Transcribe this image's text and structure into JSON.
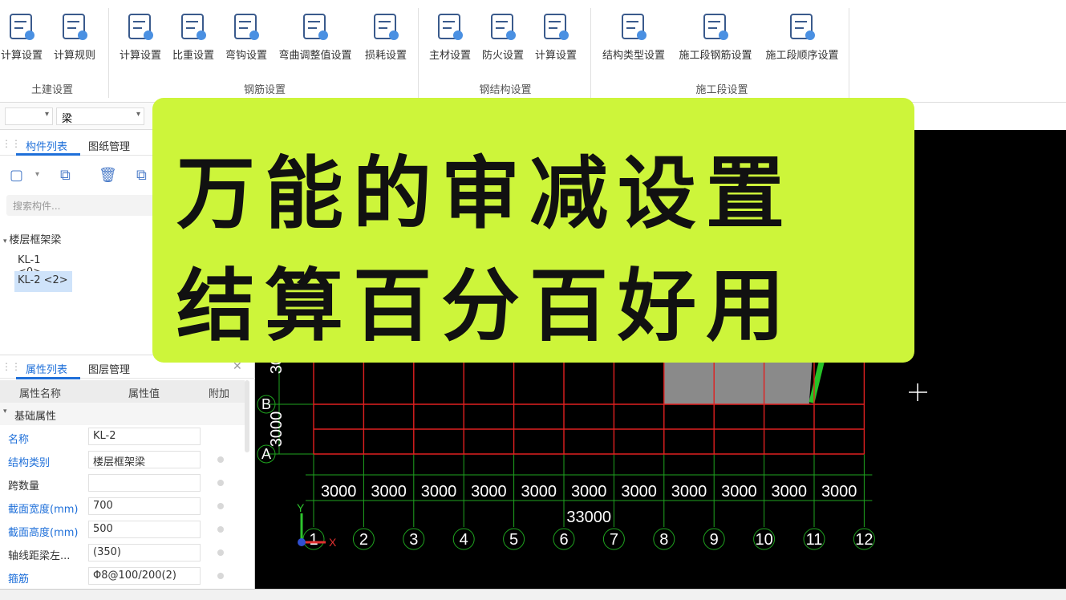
{
  "ribbon": {
    "tools": [
      {
        "label": "计算设置",
        "icon": "calc-settings-icon"
      },
      {
        "label": "计算规则",
        "icon": "calc-rules-icon"
      },
      {
        "label": "计算设置",
        "icon": "calc-settings-icon"
      },
      {
        "label": "比重设置",
        "icon": "density-settings-icon"
      },
      {
        "label": "弯钩设置",
        "icon": "hook-settings-icon"
      },
      {
        "label": "弯曲调整值设置",
        "icon": "bend-adjust-icon"
      },
      {
        "label": "损耗设置",
        "icon": "loss-settings-icon"
      },
      {
        "label": "主材设置",
        "icon": "main-material-icon"
      },
      {
        "label": "防火设置",
        "icon": "fireproof-icon"
      },
      {
        "label": "计算设置",
        "icon": "calc-settings-icon"
      },
      {
        "label": "结构类型设置",
        "icon": "structure-type-icon"
      },
      {
        "label": "施工段钢筋设置",
        "icon": "segment-rebar-icon"
      },
      {
        "label": "施工段顺序设置",
        "icon": "segment-order-icon"
      }
    ],
    "groups": [
      "土建设置",
      "钢筋设置",
      "钢结构设置",
      "施工段设置"
    ]
  },
  "left": {
    "filter_value": "梁",
    "tabs_top": [
      "构件列表",
      "图纸管理"
    ],
    "search_placeholder": "搜索构件...",
    "tree_root": "楼层框架梁",
    "tree_items": [
      "KL-1 <0>",
      "KL-2 <2>"
    ],
    "tabs_bottom": [
      "属性列表",
      "图层管理"
    ],
    "prop_headers": [
      "属性名称",
      "属性值",
      "附加"
    ],
    "section": "基础属性",
    "props": [
      {
        "name": "名称",
        "value": "KL-2",
        "blue": true
      },
      {
        "name": "结构类别",
        "value": "楼层框架梁",
        "blue": true
      },
      {
        "name": "跨数量",
        "value": "",
        "blue": false
      },
      {
        "name": "截面宽度(mm)",
        "value": "700",
        "blue": true
      },
      {
        "name": "截面高度(mm)",
        "value": "500",
        "blue": true
      },
      {
        "name": "轴线距梁左...",
        "value": "(350)",
        "blue": false
      },
      {
        "name": "箍筋",
        "value": "Φ8@100/200(2)",
        "blue": true
      }
    ]
  },
  "overlay": {
    "line1": "万能的审减设置",
    "line2": "结算百分百好用",
    "bg_color": "#cdf53a"
  },
  "canvas": {
    "row_labels": [
      "A",
      "B"
    ],
    "row_dims": [
      "3000",
      "3000"
    ],
    "col_dims": [
      "3000",
      "3000",
      "3000",
      "3000",
      "3000",
      "3000",
      "3000",
      "3000",
      "3000",
      "3000",
      "3000"
    ],
    "total_dim": "33000",
    "axis_labels": [
      "1",
      "2",
      "3",
      "4",
      "5",
      "6",
      "7",
      "8",
      "9",
      "10",
      "11",
      "12"
    ],
    "axis_y": "Y",
    "axis_x": "X",
    "grid_color": "#e02020",
    "dim_color": "#1fa51f"
  }
}
